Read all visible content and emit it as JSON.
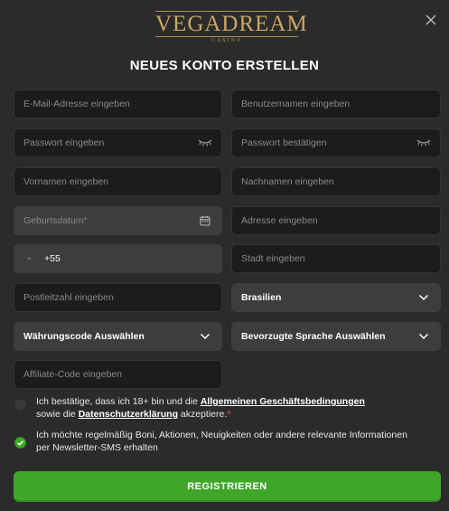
{
  "brand": {
    "name": "VEGADREAM",
    "sub": "CASINO"
  },
  "title": "NEUES KONTO ERSTELLEN",
  "fields": {
    "email": "E-Mail-Adresse eingeben",
    "username": "Benutzernamen eingeben",
    "password": "Passwort eingeben",
    "password_confirm": "Passwort bestätigen",
    "firstname": "Vornamen eingeben",
    "lastname": "Nachnamen eingeben",
    "birthdate": "Geburtsdatum*",
    "address": "Adresse eingeben",
    "phone_prefix": "+55",
    "city": "Stadt eingeben",
    "postcode": "Postleitzahl eingeben",
    "country": "Brasilien",
    "currency": "Währungscode Auswählen",
    "language": "Bevorzugte Sprache Auswählen",
    "affiliate": "Affiliate-Code eingeben"
  },
  "terms": {
    "part1": "Ich bestätige, dass ich 18+ bin und die ",
    "link1": "Allgemeinen Geschäftsbedingungen",
    "part2": "sowie die ",
    "link2": "Datenschutzerklärung",
    "part3": " akzeptiere.",
    "required_mark": "*",
    "checked": false
  },
  "newsletter": {
    "text": "Ich möchte regelmäßig Boni, Aktionen, Neuigkeiten oder andere relevante Informationen per Newsletter-SMS erhalten",
    "checked": true
  },
  "submit_label": "REGISTRIEREN",
  "colors": {
    "accent": "#3fa62a",
    "gold": "#c9a866",
    "required": "#ff4d4d"
  }
}
